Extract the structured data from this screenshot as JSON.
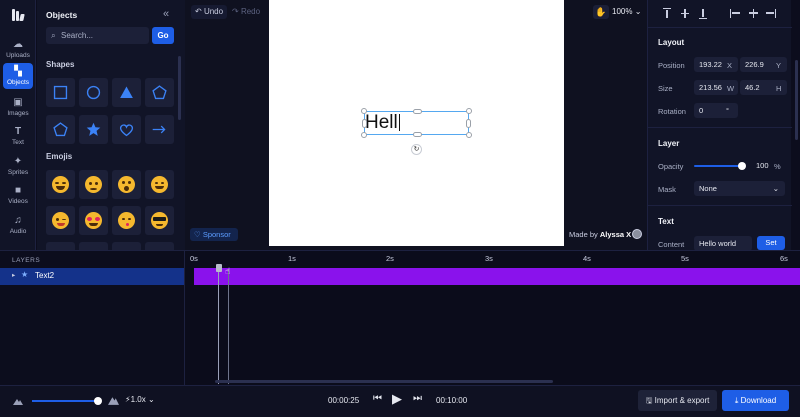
{
  "rail": {
    "items": [
      {
        "label": "Uploads",
        "icon": "cloud-upload-icon"
      },
      {
        "label": "Objects",
        "icon": "objects-icon"
      },
      {
        "label": "Images",
        "icon": "image-icon"
      },
      {
        "label": "Text",
        "icon": "text-icon"
      },
      {
        "label": "Sprites",
        "icon": "sprites-icon"
      },
      {
        "label": "Videos",
        "icon": "video-icon"
      },
      {
        "label": "Audio",
        "icon": "audio-icon"
      }
    ]
  },
  "objects_panel": {
    "title": "Objects",
    "search_placeholder": "Search...",
    "go_label": "Go",
    "shapes_title": "Shapes",
    "shapes": [
      "square",
      "circle",
      "triangle",
      "pentagon",
      "pentagon-outline",
      "star",
      "heart",
      "arrow"
    ],
    "emojis_title": "Emojis",
    "emojis": [
      "joy",
      "worried",
      "surprised",
      "smile",
      "wink",
      "heart-eyes",
      "kiss",
      "sunglasses"
    ]
  },
  "toolbar": {
    "undo_label": "Undo",
    "redo_label": "Redo",
    "zoom": "100%"
  },
  "canvas": {
    "selected_text": "Hell",
    "sponsor_label": "Sponsor",
    "made_by_prefix": "Made by",
    "made_by_name": "Alyssa X"
  },
  "properties": {
    "layout_title": "Layout",
    "position_label": "Position",
    "position_x": "193.22",
    "position_y": "226.9",
    "unit_x": "X",
    "unit_y": "Y",
    "size_label": "Size",
    "size_w": "213.56",
    "size_h": "46.2",
    "unit_w": "W",
    "unit_h": "H",
    "rotation_label": "Rotation",
    "rotation_value": "0",
    "layer_title": "Layer",
    "opacity_label": "Opacity",
    "opacity_value": "100",
    "opacity_unit": "%",
    "opacity_level": 1.0,
    "mask_label": "Mask",
    "mask_value": "None",
    "text_title": "Text",
    "content_label": "Content",
    "content_value": "Hello world",
    "set_label": "Set"
  },
  "timeline": {
    "layers_title": "LAYERS",
    "layers": [
      {
        "name": "Text2"
      }
    ],
    "ticks": [
      "0s",
      "1s",
      "2s",
      "3s",
      "4s",
      "5s",
      "6s"
    ]
  },
  "bottombar": {
    "speed": "1.0x",
    "current_time": "00:00:25",
    "end_time": "00:10:00",
    "import_label": "Import & export",
    "download_label": "Download"
  },
  "colors": {
    "accent": "#1e5ee6",
    "clip": "#8a12ec",
    "selection": "#55a8f0"
  }
}
